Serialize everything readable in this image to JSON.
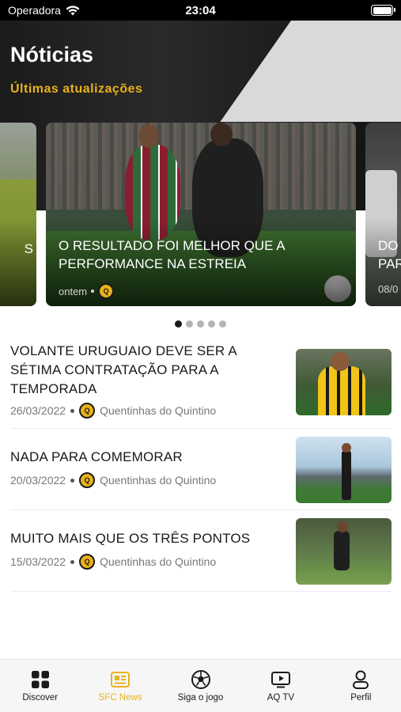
{
  "status_bar": {
    "carrier": "Operadora",
    "time": "23:04"
  },
  "header": {
    "title": "Nóticias",
    "subtitle": "Últimas atualizações"
  },
  "carousel": {
    "left_card": {
      "headline_fragment": "S"
    },
    "main_card": {
      "headline": "O RESULTADO FOI MELHOR QUE A PERFORMANCE NA ESTREIA",
      "date": "ontem"
    },
    "right_card": {
      "headline_fragment": "DO PAR",
      "date_fragment": "08/0"
    },
    "pages": 5,
    "active_page": 1
  },
  "news": [
    {
      "title": "VOLANTE URUGUAIO DEVE SER A SÉTIMA CONTRATAÇÃO PARA A TEMPORADA",
      "date": "26/03/2022",
      "source": "Quentinhas do Quintino"
    },
    {
      "title": "NADA PARA COMEMORAR",
      "date": "20/03/2022",
      "source": "Quentinhas do Quintino"
    },
    {
      "title": "MUITO MAIS QUE OS TRÊS PONTOS",
      "date": "15/03/2022",
      "source": "Quentinhas do Quintino"
    }
  ],
  "tabs": [
    {
      "label": "Discover",
      "icon": "grid-icon"
    },
    {
      "label": "SFC News",
      "icon": "newspaper-icon",
      "active": true
    },
    {
      "label": "Siga o jogo",
      "icon": "soccer-ball-icon"
    },
    {
      "label": "AQ TV",
      "icon": "play-tv-icon"
    },
    {
      "label": "Perfil",
      "icon": "person-icon"
    }
  ],
  "colors": {
    "accent": "#e9b21a",
    "header_bg": "#1b1b1b",
    "text": "#1a1a1a"
  }
}
